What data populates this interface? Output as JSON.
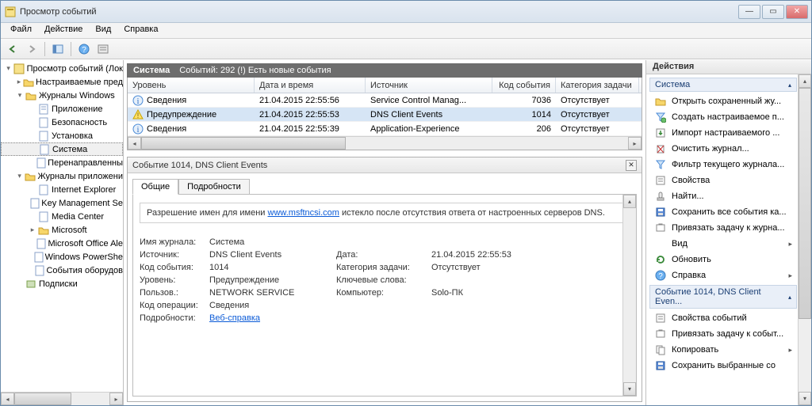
{
  "window": {
    "title": "Просмотр событий"
  },
  "menu": {
    "file": "Файл",
    "action": "Действие",
    "view": "Вид",
    "help": "Справка"
  },
  "tree": {
    "root": "Просмотр событий (Лок",
    "custom": "Настраиваемые пред",
    "winlogs": "Журналы Windows",
    "app": "Приложение",
    "security": "Безопасность",
    "setup": "Установка",
    "system": "Система",
    "forwarded": "Перенаправленны",
    "applogs": "Журналы приложени",
    "ie": "Internet Explorer",
    "kms": "Key Management Se",
    "media": "Media Center",
    "ms": "Microsoft",
    "msoff": "Microsoft Office Ale",
    "ps": "Windows PowerShe",
    "hw": "События оборудов",
    "subs": "Подписки"
  },
  "mid": {
    "title": "Система",
    "summary": "Событий: 292 (!) Есть новые события",
    "cols": {
      "level": "Уровень",
      "date": "Дата и время",
      "source": "Источник",
      "eventid": "Код события",
      "taskcat": "Категория задачи"
    },
    "rows": [
      {
        "level": "Сведения",
        "icon": "info",
        "date": "21.04.2015 22:55:56",
        "source": "Service Control Manag...",
        "eventid": "7036",
        "taskcat": "Отсутствует"
      },
      {
        "level": "Предупреждение",
        "icon": "warn",
        "date": "21.04.2015 22:55:53",
        "source": "DNS Client Events",
        "eventid": "1014",
        "taskcat": "Отсутствует"
      },
      {
        "level": "Сведения",
        "icon": "info",
        "date": "21.04.2015 22:55:39",
        "source": "Application-Experience",
        "eventid": "206",
        "taskcat": "Отсутствует"
      }
    ]
  },
  "detail": {
    "hdr": "Событие 1014, DNS Client Events",
    "tab_general": "Общие",
    "tab_details": "Подробности",
    "msg_before": "Разрешение имен для имени ",
    "msg_link": "www.msftncsi.com",
    "msg_after": " истекло после отсутствия ответа от настроенных серверов DNS.",
    "labels": {
      "log": "Имя журнала:",
      "source": "Источник:",
      "eventid": "Код события:",
      "level": "Уровень:",
      "user": "Пользов.:",
      "opcode": "Код операции:",
      "moreinfo": "Подробности:",
      "date_l": "Дата:",
      "taskcat_l": "Категория задачи:",
      "keywords_l": "Ключевые слова:",
      "computer_l": "Компьютер:"
    },
    "values": {
      "log": "Система",
      "source": "DNS Client Events",
      "eventid": "1014",
      "level": "Предупреждение",
      "user": "NETWORK SERVICE",
      "opcode": "Сведения",
      "date_v": "21.04.2015 22:55:53",
      "taskcat_v": "Отсутствует",
      "keywords_v": "",
      "computer_v": "Solo-ПК",
      "helplink": "Веб-справка "
    }
  },
  "actions": {
    "title": "Действия",
    "sect1": "Система",
    "items1": [
      {
        "icon": "open",
        "label": "Открыть сохраненный жу..."
      },
      {
        "icon": "filteradd",
        "label": "Создать настраиваемое п..."
      },
      {
        "icon": "import",
        "label": "Импорт настраиваемого ..."
      },
      {
        "icon": "clear",
        "label": "Очистить журнал..."
      },
      {
        "icon": "filter",
        "label": "Фильтр текущего журнала..."
      },
      {
        "icon": "props",
        "label": "Свойства"
      },
      {
        "icon": "find",
        "label": "Найти..."
      },
      {
        "icon": "save",
        "label": "Сохранить все события ка..."
      },
      {
        "icon": "attach",
        "label": "Привязать задачу к журна..."
      },
      {
        "icon": "view",
        "label": "Вид",
        "sub": true
      },
      {
        "icon": "refresh",
        "label": "Обновить"
      },
      {
        "icon": "help",
        "label": "Справка",
        "sub": true
      }
    ],
    "sect2": "Событие 1014, DNS Client Even...",
    "items2": [
      {
        "icon": "props",
        "label": "Свойства событий"
      },
      {
        "icon": "attach",
        "label": "Привязать задачу к событ..."
      },
      {
        "icon": "copy",
        "label": "Копировать",
        "sub": true
      },
      {
        "icon": "save",
        "label": "Сохранить выбранные со"
      }
    ]
  }
}
